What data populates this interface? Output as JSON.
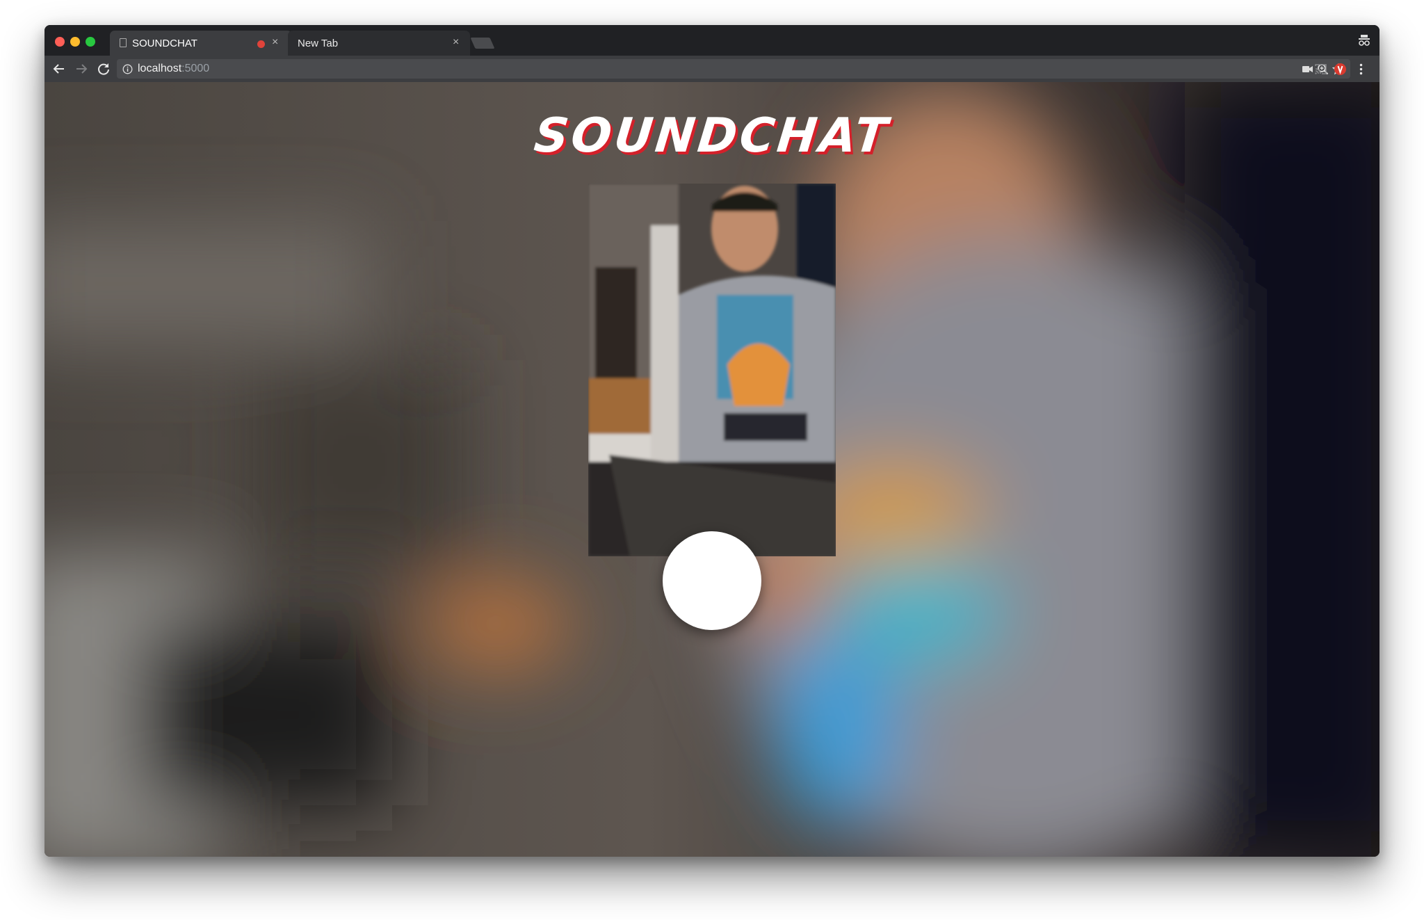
{
  "browser": {
    "tabs": [
      {
        "title": "SOUNDCHAT",
        "active": true,
        "recording": true
      },
      {
        "title": "New Tab",
        "active": false
      }
    ],
    "address": {
      "host": "localhost",
      "port": ":5000"
    }
  },
  "page": {
    "logo": "SOUNDCHAT",
    "colors": {
      "logo_text": "#ffffff",
      "logo_shadow": "#d4202a",
      "record_button": "#ffffff"
    }
  }
}
